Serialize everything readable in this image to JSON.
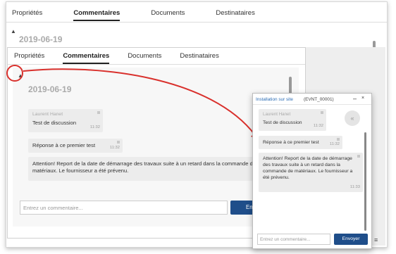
{
  "tabs": [
    "Propriétés",
    "Commentaires",
    "Documents",
    "Destinataires"
  ],
  "active_tab": "Commentaires",
  "pin_icon": "pin-icon",
  "date": "2019-06-19",
  "comments": [
    {
      "author": "Laurent Hanet",
      "text": "Test de discussion",
      "time": "11:32"
    },
    {
      "author": "",
      "text": "Réponse à ce premier test",
      "time": "11:32"
    },
    {
      "author": "",
      "text_mid": "Attention! Report de la date de démarrage des travaux suite à un retard dans la commande de matériaux. Le fournisseur a été prévenu.",
      "text_chat": "Attention! Report de la date de démarrage des travaux suite à un retard dans la commande de matériaux. Le fournisseur a été prévenu.",
      "time": "11:33"
    }
  ],
  "input_placeholder": "Entrez un commentaire...",
  "send_label": "Envoyer",
  "send_label_truncated": "En",
  "chat": {
    "title": "Installation sur site",
    "event_id": "(EVNT_00001)",
    "minimize": "–",
    "close": "×",
    "scroll_icon": "«"
  },
  "bottom_menu_icon": "≡",
  "colors": {
    "accent": "#1f4e8a",
    "link": "#2c6db5",
    "annotation": "#d9302c",
    "bubble": "#ececec",
    "date": "#aaaaaa"
  }
}
